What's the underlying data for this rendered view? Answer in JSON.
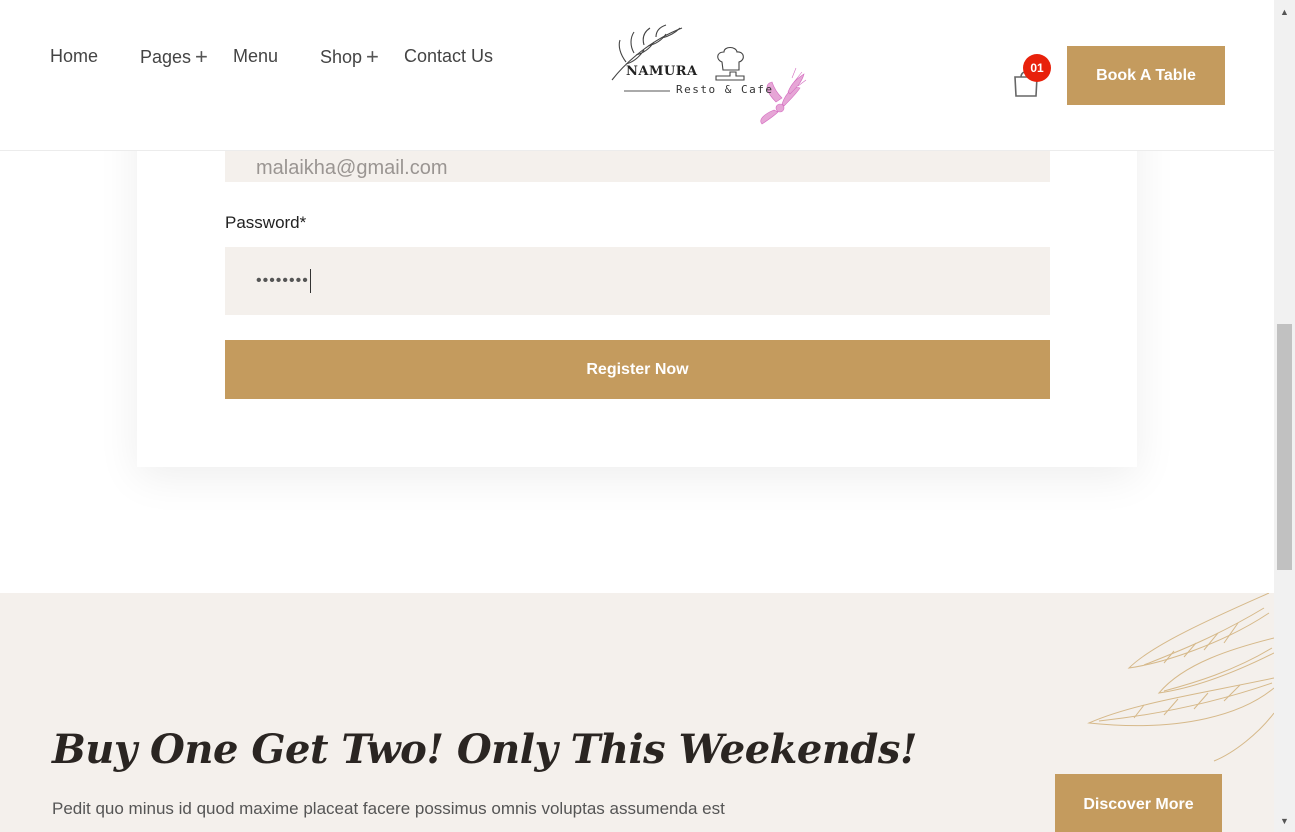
{
  "header": {
    "nav": [
      {
        "label": "Home",
        "has_submenu": false
      },
      {
        "label": "Pages",
        "has_submenu": true
      },
      {
        "label": "Menu",
        "has_submenu": false
      },
      {
        "label": "Shop",
        "has_submenu": true
      },
      {
        "label": "Contact Us",
        "has_submenu": false
      }
    ],
    "submenu_icon": "+",
    "logo": {
      "name": "NAMURA",
      "tagline": "Resto & Cafe"
    },
    "cart": {
      "icon": "shopping-bag-icon",
      "count": "01"
    },
    "book_button": "Book A Table"
  },
  "form": {
    "email_value": "malaikha@gmail.com",
    "password_label": "Password*",
    "password_value": "••••••••",
    "register_button": "Register Now"
  },
  "promo": {
    "title": "Buy One Get Two! Only This Weekends!",
    "text": "Pedit quo minus id quod maxime placeat facere possimus omnis voluptas assumenda est",
    "button": "Discover More"
  },
  "scrollbar": {
    "up_icon": "▲",
    "down_icon": "▼"
  },
  "colors": {
    "accent": "#c49b5e",
    "badge": "#e8210b",
    "field_bg": "#f4f0ec",
    "promo_bg": "#f4f0ec"
  }
}
